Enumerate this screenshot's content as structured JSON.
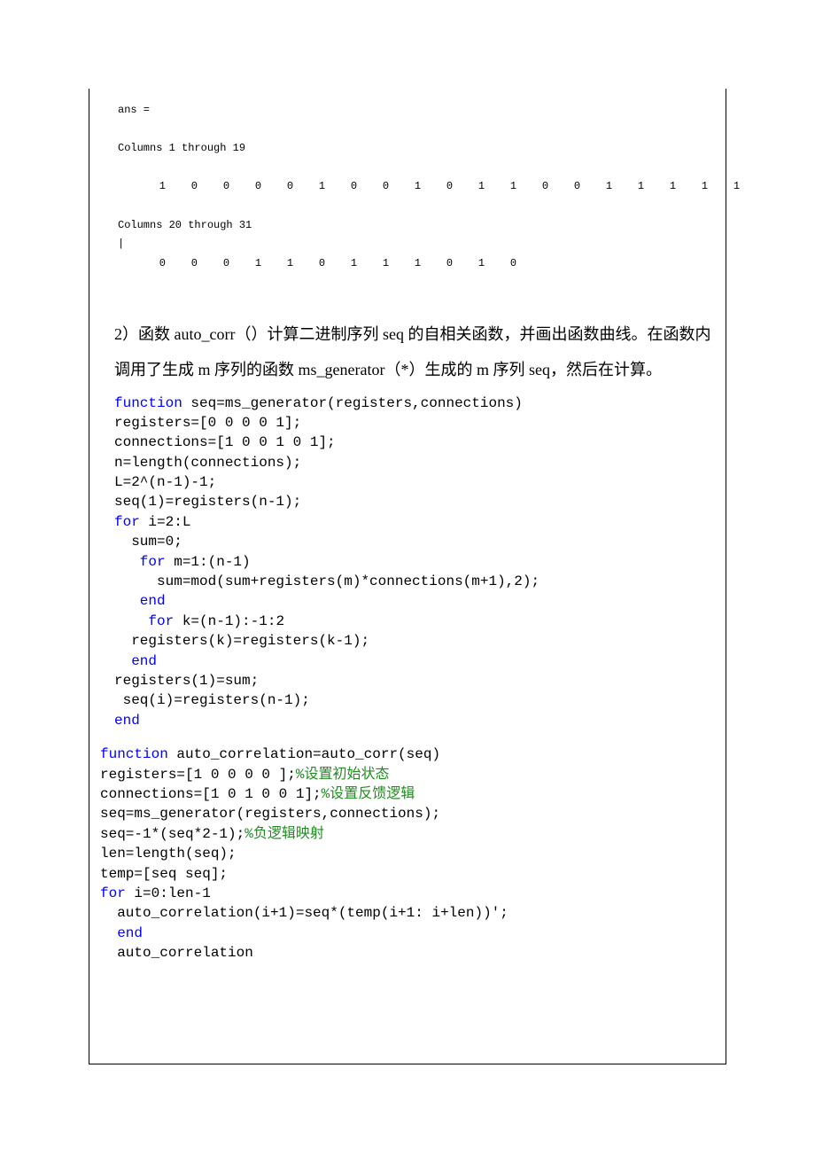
{
  "matlab": {
    "ans_label": "ans =",
    "cols1": "Columns 1 through 19",
    "row1": "    1    0    0    0    0    1    0    0    1    0    1    1    0    0    1    1    1    1    1",
    "cols2": "Columns 20 through 31",
    "row2": "    0    0    0    1    1    0    1    1    1    0    1    0"
  },
  "paragraph": {
    "text": "2）函数 auto_corr（）计算二进制序列 seq 的自相关函数，并画出函数曲线。在函数内调用了生成 m 序列的函数 ms_generator（*）生成的 m 序列 seq，然后在计算。"
  },
  "code1": {
    "l1a": "function",
    "l1b": " seq=ms_generator(registers,connections)",
    "l2": "registers=[0 0 0 0 1];",
    "l3": "connections=[1 0 0 1 0 1];",
    "l4": "n=length(connections);",
    "l5": "L=2^(n-1)-1;",
    "l6": "seq(1)=registers(n-1);",
    "l7a": "for",
    "l7b": " i=2:L",
    "l8": "  sum=0;",
    "l9a": "   for",
    "l9b": " m=1:(n-1)",
    "l10": "     sum=mod(sum+registers(m)*connections(m+1),2);",
    "l11": "   end",
    "l12a": "    for",
    "l12b": " k=(n-1):-1:2",
    "l13": "  registers(k)=registers(k-1);",
    "l14": "  end",
    "l15": "registers(1)=sum;",
    "l16": " seq(i)=registers(n-1);",
    "l17": "end"
  },
  "code2": {
    "l1a": "function",
    "l1b": " auto_correlation=auto_corr(seq)",
    "l2": "registers=[1 0 0 0 0 ];",
    "l2c": "%设置初始状态",
    "l3": "connections=[1 0 1 0 0 1];",
    "l3c": "%设置反馈逻辑",
    "l4": "seq=ms_generator(registers,connections);",
    "l5": "seq=-1*(seq*2-1);",
    "l5c": "%负逻辑映射",
    "l6": "len=length(seq);",
    "l7": "temp=[seq seq];",
    "l8a": "for",
    "l8b": " i=0:len-1",
    "l9": "  auto_correlation(i+1)=seq*(temp(i+1: i+len))';",
    "l10": "  end",
    "l11": "  auto_correlation"
  }
}
